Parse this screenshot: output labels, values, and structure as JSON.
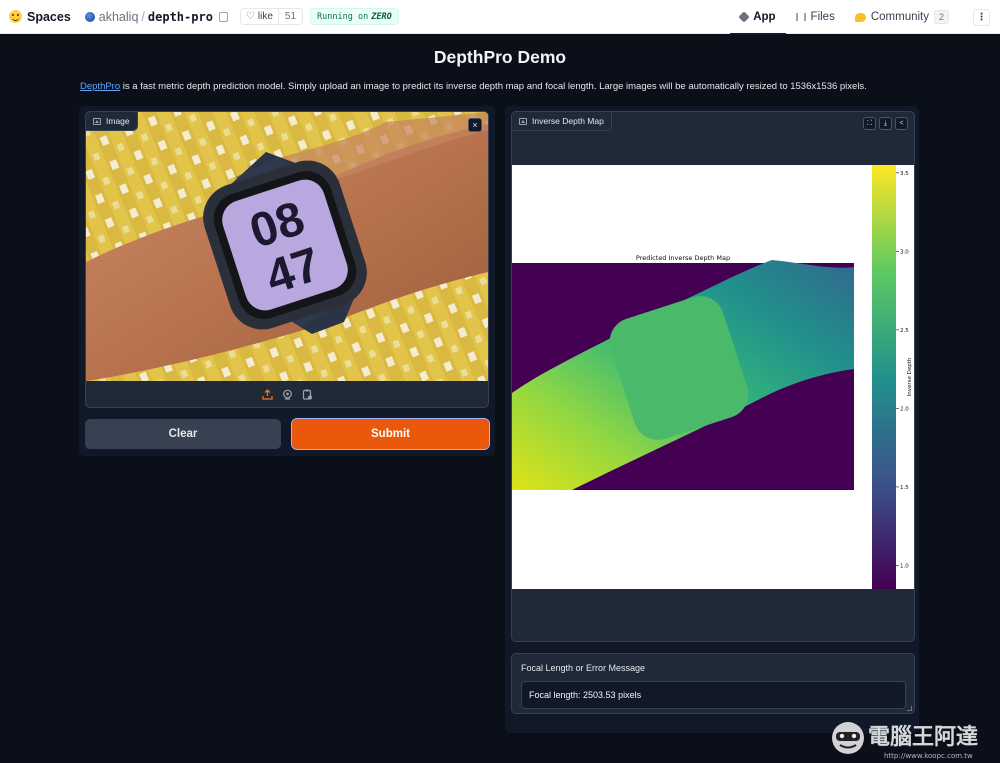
{
  "nav": {
    "brand": "Spaces",
    "owner": "akhaliq",
    "separator": "/",
    "repo": "depth-pro",
    "like_label": "like",
    "like_count": "51",
    "running_prefix": "Running on",
    "running_hw": "ZERO",
    "tabs": [
      {
        "label": "App",
        "icon": "app-icon",
        "active": true
      },
      {
        "label": "Files",
        "icon": "files-icon",
        "active": false
      },
      {
        "label": "Community",
        "icon": "community-icon",
        "active": false,
        "badge": "2"
      }
    ]
  },
  "page": {
    "title": "DepthPro Demo",
    "desc_link": "DepthPro",
    "desc_text": " is a fast metric depth prediction model. Simply upload an image to predict its inverse depth map and focal length. Large images will be automatically resized to 1536x1536 pixels."
  },
  "input_image": {
    "label": "Image",
    "close_icon": "×"
  },
  "buttons": {
    "clear": "Clear",
    "submit": "Submit"
  },
  "output_image": {
    "label": "Inverse Depth Map"
  },
  "chart_data": {
    "type": "heatmap",
    "title": "Predicted Inverse Depth Map",
    "colorbar_label": "Inverse Depth",
    "colormap": "viridis",
    "colorbar_range": [
      0.85,
      3.55
    ],
    "colorbar_ticks": [
      "3.5",
      "3.0",
      "2.5",
      "2.0",
      "1.5",
      "1.0"
    ]
  },
  "focal": {
    "label": "Focal Length or Error Message",
    "value": "Focal length: 2503.53 pixels"
  },
  "watermark": {
    "text": "電腦王阿達",
    "url": "http://www.koopc.com.tw"
  },
  "colors": {
    "background": "#0b0f19",
    "panel": "#111827",
    "block": "#1f2937",
    "submit": "#ea580c",
    "link": "#60a5fa"
  }
}
